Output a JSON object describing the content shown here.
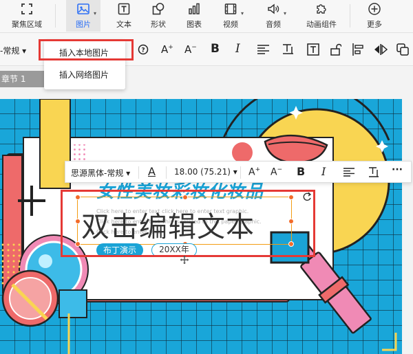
{
  "ribbon": {
    "buttons": [
      {
        "label": "聚焦区域",
        "icon": "focus-area-icon"
      },
      {
        "label": "图片",
        "icon": "picture-icon"
      },
      {
        "label": "文本",
        "icon": "text-box-icon"
      },
      {
        "label": "形状",
        "icon": "shape-icon"
      },
      {
        "label": "图表",
        "icon": "chart-icon"
      },
      {
        "label": "视频",
        "icon": "video-icon"
      },
      {
        "label": "音频",
        "icon": "audio-icon"
      },
      {
        "label": "动画组件",
        "icon": "puzzle-icon"
      },
      {
        "label": "更多",
        "icon": "plus-circle-icon"
      }
    ]
  },
  "toolbar2": {
    "font_style": "-常规"
  },
  "picture_menu": {
    "items": [
      "插入本地图片",
      "插入网络图片"
    ]
  },
  "section_tab": {
    "label": "章节 1"
  },
  "float_toolbar": {
    "font_family": "思源黑体-常规",
    "font_size": "18.00 (75.21)"
  },
  "slide": {
    "title_partial": "女性美妆彩妆化妆品",
    "main_text": "双击编辑文本",
    "body_lines": [
      "Click here to enter text  click here to enter text  graphic.",
      "Click here to enter text  This is related to this paper graphic.",
      "Click here to enter text"
    ],
    "pill_1": "布丁演示",
    "pill_2": "20XX年"
  },
  "colors": {
    "accent_blue": "#2c6ff5",
    "slide_blue": "#1aa3d6",
    "highlight_red": "#e53935",
    "handle_orange": "#f26b2a",
    "yellow": "#f9d552",
    "pink": "#f08ab5",
    "coral": "#ee6a6a"
  }
}
